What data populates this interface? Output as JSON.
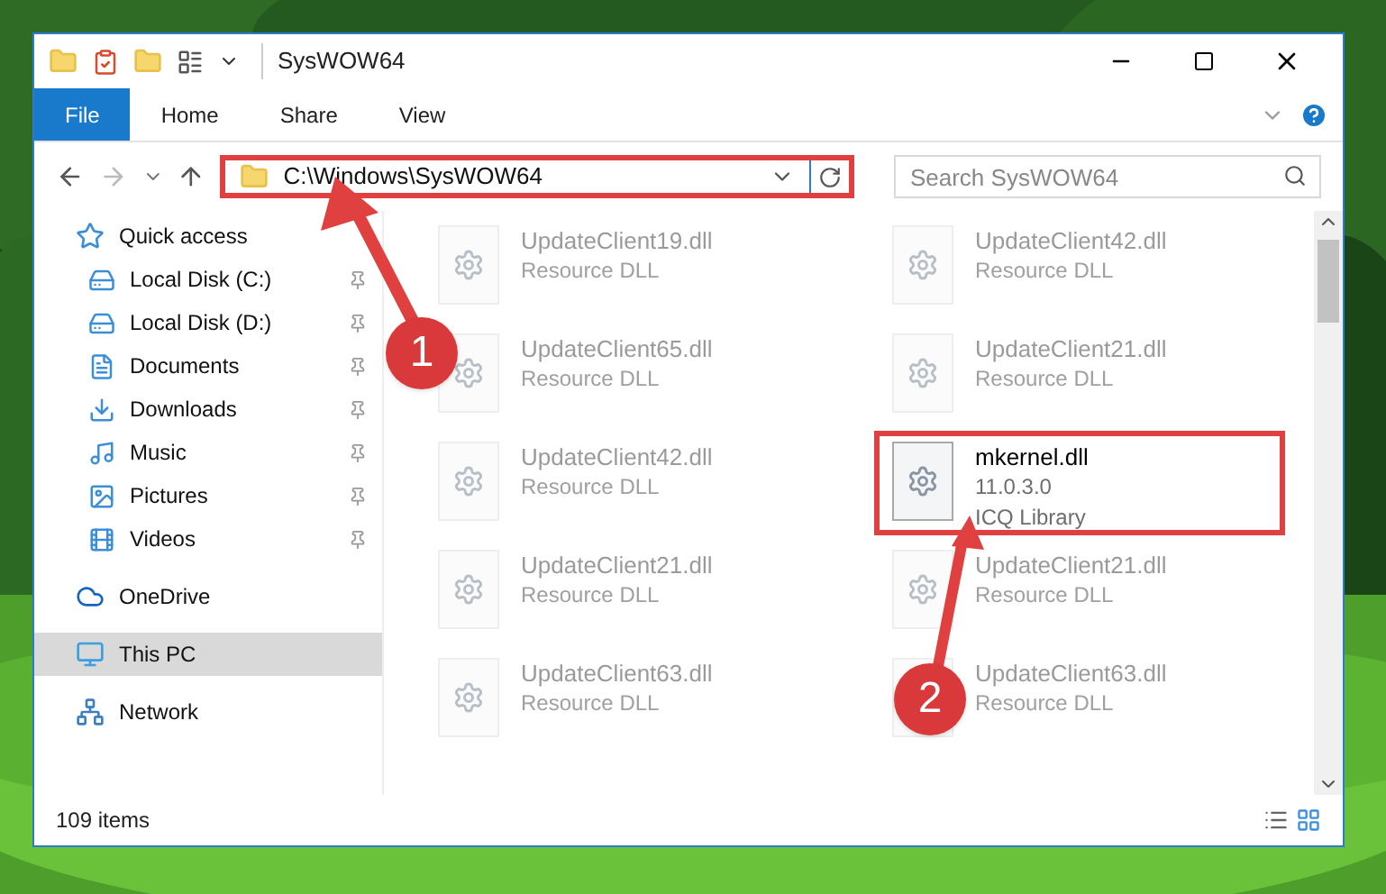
{
  "window": {
    "title": "SysWOW64"
  },
  "ribbon_tabs": [
    {
      "label": "File",
      "selected": true
    },
    {
      "label": "Home",
      "selected": false
    },
    {
      "label": "Share",
      "selected": false
    },
    {
      "label": "View",
      "selected": false
    }
  ],
  "address_bar": {
    "path": "C:\\Windows\\SysWOW64",
    "highlighted": true
  },
  "search": {
    "placeholder": "Search SysWOW64"
  },
  "sidebar": {
    "items": [
      {
        "label": "Quick access",
        "selected": false,
        "children": [
          {
            "label": "Local Disk (C:)",
            "selected": false,
            "pinned": true
          },
          {
            "label": "Local Disk (D:)",
            "selected": false,
            "pinned": true
          },
          {
            "label": "Documents",
            "selected": false,
            "pinned": true
          },
          {
            "label": "Downloads",
            "selected": false,
            "pinned": true
          },
          {
            "label": "Music",
            "selected": false,
            "pinned": true
          },
          {
            "label": "Pictures",
            "selected": false,
            "pinned": true
          },
          {
            "label": "Videos",
            "selected": false,
            "pinned": true
          }
        ]
      },
      {
        "label": "OneDrive",
        "selected": false
      },
      {
        "label": "This PC",
        "selected": true
      },
      {
        "label": "Network",
        "selected": false
      }
    ]
  },
  "files": [
    {
      "name": "UpdateClient19.dll",
      "lines": [
        "Resource DLL"
      ],
      "blurred": true,
      "highlighted": false
    },
    {
      "name": "UpdateClient42.dll",
      "lines": [
        "Resource DLL"
      ],
      "blurred": true,
      "highlighted": false
    },
    {
      "name": "UpdateClient65.dll",
      "lines": [
        "Resource DLL"
      ],
      "blurred": true,
      "highlighted": false
    },
    {
      "name": "UpdateClient21.dll",
      "lines": [
        "Resource DLL"
      ],
      "blurred": true,
      "highlighted": false
    },
    {
      "name": "UpdateClient42.dll",
      "lines": [
        "Resource DLL"
      ],
      "blurred": true,
      "highlighted": false
    },
    {
      "name": "mkernel.dll",
      "lines": [
        "11.0.3.0",
        "ICQ Library"
      ],
      "blurred": false,
      "highlighted": true
    },
    {
      "name": "UpdateClient21.dll",
      "lines": [
        "Resource DLL"
      ],
      "blurred": true,
      "highlighted": false
    },
    {
      "name": "UpdateClient21.dll",
      "lines": [
        "Resource DLL"
      ],
      "blurred": true,
      "highlighted": false
    },
    {
      "name": "UpdateClient63.dll",
      "lines": [
        "Resource DLL"
      ],
      "blurred": true,
      "highlighted": false
    },
    {
      "name": "UpdateClient63.dll",
      "lines": [
        "Resource DLL"
      ],
      "blurred": true,
      "highlighted": false
    }
  ],
  "status_bar": {
    "item_count": "109 items"
  },
  "callouts": [
    {
      "label": "1"
    },
    {
      "label": "2"
    }
  ]
}
